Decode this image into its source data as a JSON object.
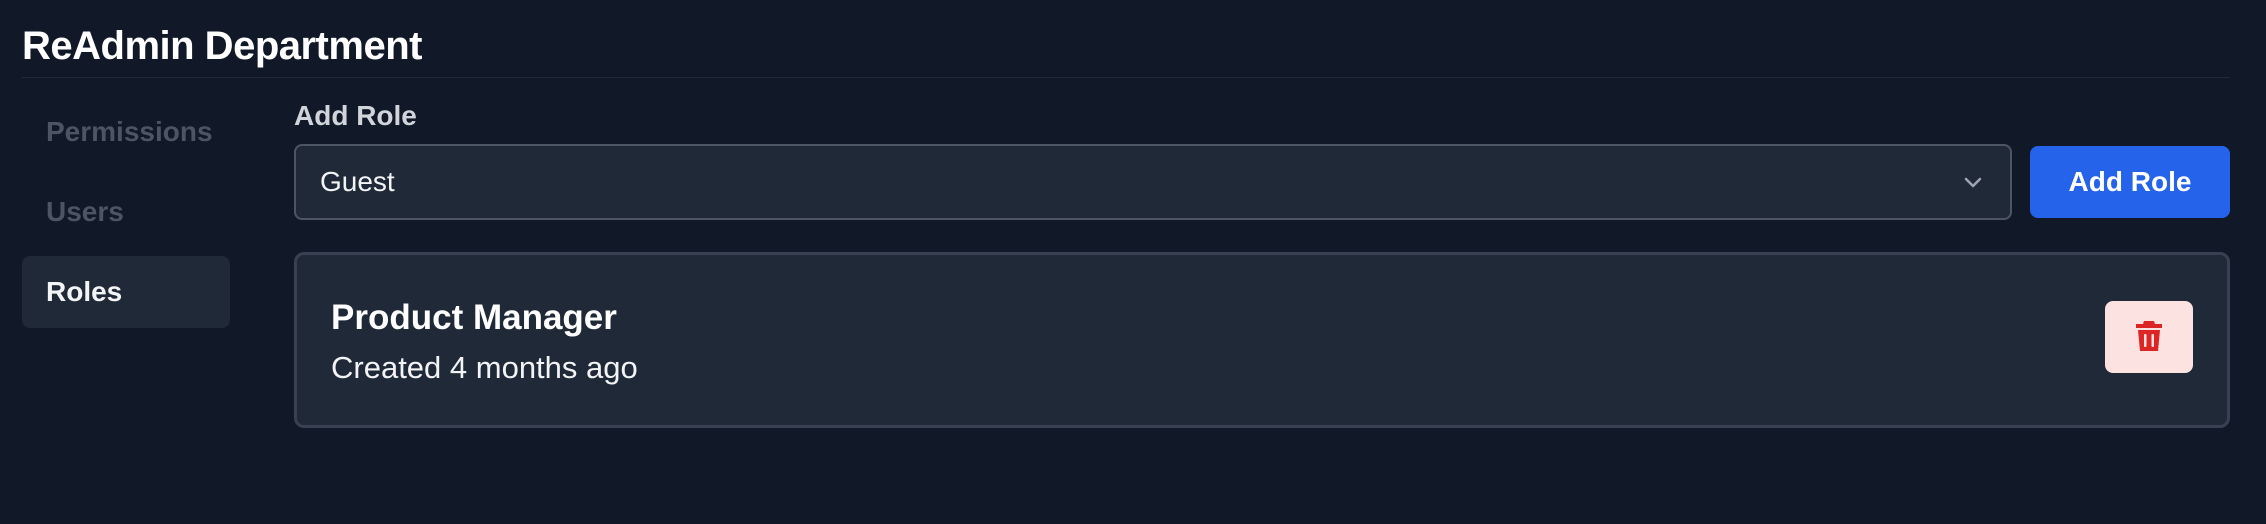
{
  "header": {
    "title": "ReAdmin Department"
  },
  "sidebar": {
    "items": [
      {
        "label": "Permissions",
        "active": false
      },
      {
        "label": "Users",
        "active": false
      },
      {
        "label": "Roles",
        "active": true
      }
    ]
  },
  "main": {
    "add_role_label": "Add Role",
    "select": {
      "value": "Guest",
      "icon": "chevron-down-icon"
    },
    "add_button_label": "Add Role",
    "roles": [
      {
        "name": "Product Manager",
        "created": "Created 4 months ago",
        "delete_icon": "trash-icon"
      }
    ]
  },
  "colors": {
    "background": "#111827",
    "panel": "#1f2937",
    "accent": "#2563eb",
    "danger": "#dc2626",
    "danger_bg": "#fde2e2"
  }
}
